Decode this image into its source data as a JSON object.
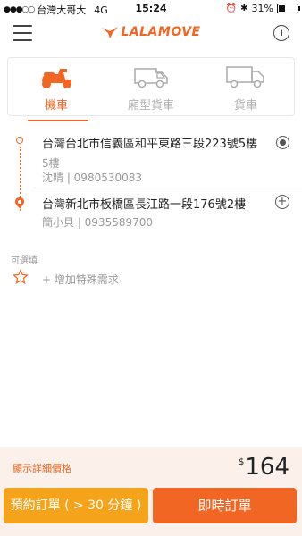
{
  "status_bar": {
    "carrier": "台灣大哥大",
    "network": "4G",
    "time": "15:24",
    "battery": "31%"
  },
  "brand": {
    "name": "LALAMOVE",
    "accent_color": "#f16622"
  },
  "vehicles": [
    {
      "label": "機車",
      "icon": "scooter-icon",
      "selected": true
    },
    {
      "label": "廂型貨車",
      "icon": "van-icon",
      "selected": false
    },
    {
      "label": "貨車",
      "icon": "truck-icon",
      "selected": false
    }
  ],
  "route": {
    "pickup": {
      "address": "台灣台北市信義區和平東路三段223號5樓",
      "floor": "5樓",
      "contact": "沈晴 | 0980530083"
    },
    "dropoff": {
      "address": "台灣新北市板橋區長江路一段176號2樓",
      "contact": "簡小貝 | 0935589700"
    }
  },
  "options": {
    "optional_label": "可選填",
    "special_request": "+ 增加特殊需求"
  },
  "footer": {
    "price_details_link": "顯示詳細價格",
    "currency": "$",
    "price": "164",
    "schedule_button": "預約訂單 ( > 30 分鐘 )",
    "order_now_button": "即時訂單"
  }
}
